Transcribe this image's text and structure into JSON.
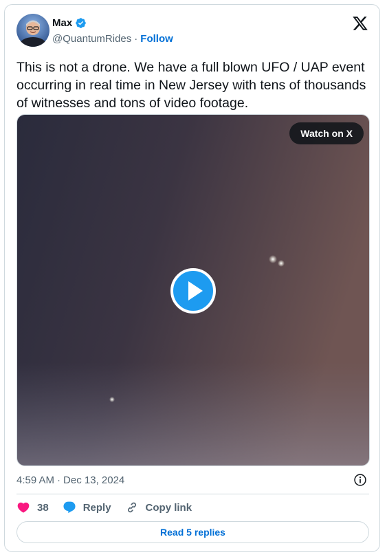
{
  "author": {
    "name": "Max",
    "handle": "@QuantumRides",
    "separator": "·",
    "follow_label": "Follow",
    "verified_color": "#1d9bf0"
  },
  "tweet": {
    "text": "This is not a drone. We have a full blown UFO / UAP event occurring in real time in New Jersey with tens of thousands of witnesses and tons of video footage.",
    "time": "4:59 AM",
    "separator": "·",
    "date": "Dec 13, 2024"
  },
  "media": {
    "watch_label": "Watch on X"
  },
  "actions": {
    "likes": "38",
    "reply_label": "Reply",
    "copy_link_label": "Copy link",
    "read_replies_label": "Read 5 replies"
  },
  "colors": {
    "accent": "#1d9bf0",
    "link": "#006fd6",
    "like": "#f91880",
    "muted": "#536471"
  },
  "icons": {
    "logo": "x-logo-icon",
    "verified": "verified-badge-icon",
    "play": "play-icon",
    "info": "info-icon",
    "like": "heart-icon",
    "reply": "reply-bubble-icon",
    "copy": "link-icon"
  }
}
